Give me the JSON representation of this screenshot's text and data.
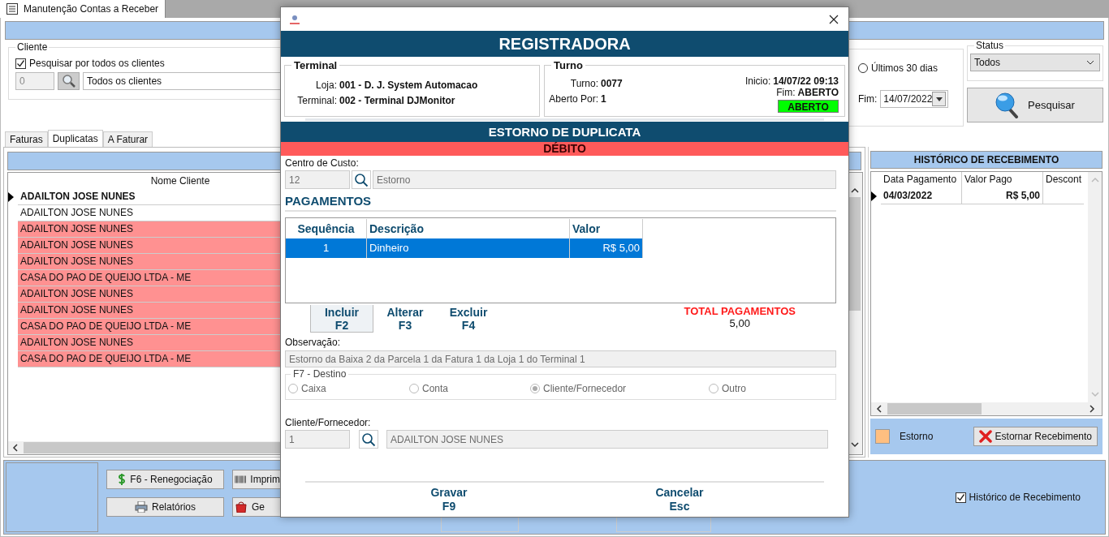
{
  "app_tab": {
    "title": "Manutenção Contas a Receber"
  },
  "client_filter": {
    "legend": "Cliente",
    "all_clients": {
      "label": "Pesquisar por todos os clientes",
      "checked": true
    },
    "code": "0",
    "name": "Todos os clientes"
  },
  "period": {
    "last_30_days": {
      "label": "Últimos 30 dias",
      "selected": false
    },
    "end_label": "Fim:",
    "end_date": "14/07/2022"
  },
  "status": {
    "legend": "Status",
    "value": "Todos"
  },
  "search_button": "Pesquisar",
  "tabs": [
    {
      "label": "Faturas",
      "selected": false
    },
    {
      "label": "Duplicatas",
      "selected": true
    },
    {
      "label": "A Faturar",
      "selected": false
    }
  ],
  "table": {
    "columns": [
      "Nome Cliente"
    ],
    "rows": [
      {
        "name": "ADAILTON JOSE NUNES",
        "current": true,
        "color": "#ffffff"
      },
      {
        "name": "ADAILTON JOSE NUNES",
        "current": false,
        "color": "#ffffff"
      },
      {
        "name": "ADAILTON JOSE NUNES",
        "current": false,
        "color": "#ff9191"
      },
      {
        "name": "ADAILTON JOSE NUNES",
        "current": false,
        "color": "#ff9191"
      },
      {
        "name": "ADAILTON JOSE NUNES",
        "current": false,
        "color": "#ff9191"
      },
      {
        "name": "CASA DO PAO DE QUEIJO LTDA - ME",
        "current": false,
        "color": "#ff9191"
      },
      {
        "name": "ADAILTON JOSE NUNES",
        "current": false,
        "color": "#ff9191"
      },
      {
        "name": "ADAILTON JOSE NUNES",
        "current": false,
        "color": "#ff9191"
      },
      {
        "name": "CASA DO PAO DE QUEIJO LTDA - ME",
        "current": false,
        "color": "#ff9191"
      },
      {
        "name": "ADAILTON JOSE NUNES",
        "current": false,
        "color": "#ff9191"
      },
      {
        "name": "CASA DO PAO DE QUEIJO LTDA - ME",
        "current": false,
        "color": "#ff9191"
      }
    ]
  },
  "history": {
    "title": "HISTÓRICO DE RECEBIMENTO",
    "columns": [
      "Data Pagamento",
      "Valor Pago",
      "Descont"
    ],
    "rows": [
      {
        "cells": [
          "04/03/2022",
          "R$ 5,00"
        ],
        "current": true
      }
    ],
    "legend": {
      "label": "Estorno",
      "color": "#ffbf80"
    },
    "button": "Estornar Recebimento"
  },
  "bottom_buttons": [
    "F6 - Renegociação",
    "Imprim",
    "Relatórios",
    "Ge"
  ],
  "history_checkbox": {
    "label": "Histórico de Recebimento",
    "checked": true
  },
  "dialog": {
    "header": "REGISTRADORA",
    "terminal": {
      "legend": "Terminal",
      "fields": [
        {
          "label": "Loja:",
          "value": "001 - D. J. System Automacao"
        },
        {
          "label": "Terminal:",
          "value": "002 - Terminal DJMonitor"
        }
      ]
    },
    "shift": {
      "legend": "Turno",
      "left": [
        {
          "label": "Turno:",
          "value": "0077"
        },
        {
          "label": "Aberto Por:",
          "value": "1"
        }
      ],
      "right": [
        {
          "label": "Inicio:",
          "value": "14/07/22 09:13"
        },
        {
          "label": "Fim:",
          "value": "ABERTO"
        }
      ],
      "badge": "ABERTO"
    },
    "operation": "ESTORNO DE DUPLICATA",
    "type": "DÉBITO",
    "cost_center": {
      "label": "Centro de Custo:",
      "code": "12",
      "name": "Estorno"
    },
    "payments": {
      "title": "PAGAMENTOS",
      "columns": [
        "Sequência",
        "Descrição",
        "Valor"
      ],
      "rows": [
        {
          "cells": [
            "1",
            "Dinheiro",
            "R$ 5,00"
          ],
          "selected": true
        }
      ]
    },
    "payment_buttons": [
      {
        "label": "Incluir",
        "key": "F2",
        "focused": true
      },
      {
        "label": "Alterar",
        "key": "F3",
        "focused": false
      },
      {
        "label": "Excluir",
        "key": "F4",
        "focused": false
      }
    ],
    "total": {
      "label": "TOTAL PAGAMENTOS",
      "value": "5,00"
    },
    "observation": {
      "label": "Observação:",
      "value": "Estorno da Baixa 2 da Parcela 1 da Fatura 1 da Loja 1 do Terminal 1"
    },
    "destination": {
      "legend": "F7 - Destino",
      "options": [
        {
          "label": "Caixa",
          "selected": false
        },
        {
          "label": "Conta",
          "selected": false
        },
        {
          "label": "Cliente/Fornecedor",
          "selected": true
        },
        {
          "label": "Outro",
          "selected": false
        }
      ]
    },
    "client": {
      "label": "Cliente/Fornecedor:",
      "code": "1",
      "name": "ADAILTON JOSE NUNES"
    },
    "actions": [
      {
        "label": "Gravar",
        "key": "F9"
      },
      {
        "label": "Cancelar",
        "key": "Esc"
      }
    ]
  }
}
